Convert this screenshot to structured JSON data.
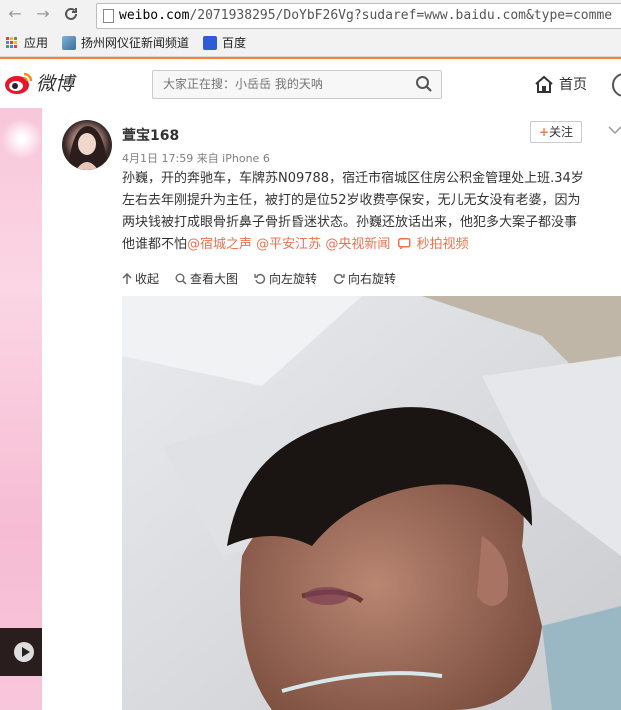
{
  "browser": {
    "url_bold": "weibo.com",
    "url_rest": "/2071938295/DoYbF26Vg?sudaref=www.baidu.com&type=comme",
    "bookmarks": [
      "应用",
      "扬州网仪征新闻频道",
      "百度"
    ]
  },
  "weibo_nav": {
    "logo_text": "微博",
    "search_placeholder": "大家正在搜：小岳岳 我的天呐",
    "home_label": "首页"
  },
  "post": {
    "user_name": "萱宝168",
    "follow_label": "关注",
    "meta": "4月1日 17:59 来自 iPhone 6",
    "text_lines": [
      "孙巍，开的奔驰车，车牌苏N09788，宿迁市宿城区住房公积金管理处上班.34岁",
      "左右去年刚提升为主任，被打的是位52岁收费亭保安，无儿无女没有老婆，因为",
      "两块钱被打成眼骨折鼻子骨折昏迷状态。孙巍还放话出来，他犯多大案子都没事",
      "他谁都不怕"
    ],
    "mentions": [
      "@宿城之声",
      "@平安江苏",
      "@央视新闻"
    ],
    "video_label": "秒拍视频",
    "toolbar": {
      "collapse": "收起",
      "view_large": "查看大图",
      "rotate_left": "向左旋转",
      "rotate_right": "向右旋转"
    }
  },
  "colors": {
    "accent": "#fa7d3c",
    "link": "#eb7350",
    "background_pink": "#f9c8dc"
  }
}
